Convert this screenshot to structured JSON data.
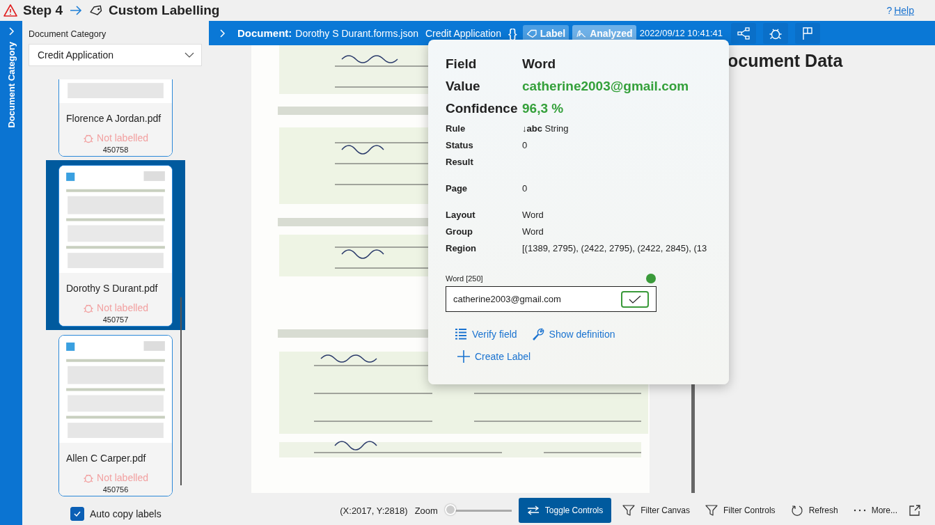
{
  "header": {
    "step": "Step 4",
    "title": "Custom Labelling",
    "help_mark": "?",
    "help": "Help"
  },
  "rail": {
    "label": "Document Category"
  },
  "category": {
    "label": "Document Category",
    "value": "Credit Application"
  },
  "documents": [
    {
      "name": "Florence A Jordan.pdf",
      "status": "Not labelled",
      "id": "450758",
      "selected": false
    },
    {
      "name": "Dorothy S Durant.pdf",
      "status": "Not labelled",
      "id": "450757",
      "selected": true
    },
    {
      "name": "Allen C Carper.pdf",
      "status": "Not labelled",
      "id": "450756",
      "selected": false
    }
  ],
  "auto_copy": {
    "label": "Auto copy labels",
    "checked": true
  },
  "toolbar": {
    "prefix": "Document:",
    "file": "Dorothy S Durant.forms.json",
    "category": "Credit Application",
    "braces": "{}",
    "chips": [
      {
        "label": "Label",
        "kind": "tag"
      },
      {
        "label": "Analyzed",
        "kind": "sign"
      }
    ],
    "timestamp": "2022/09/12 10:41:41"
  },
  "data_heading": "ocument Data",
  "popup": {
    "sections": [
      [
        {
          "label": "Field",
          "value": "Word",
          "kind": "heading"
        },
        {
          "label": "Value",
          "value": "catherine2003@gmail.com",
          "kind": "highlight"
        },
        {
          "label": "Confidence",
          "value": "96,3 %",
          "kind": "highlight"
        },
        {
          "label": "Rule",
          "value": "**↓abc**  String",
          "kind": "plain"
        },
        {
          "label": "Status",
          "value": "0",
          "kind": "plain"
        },
        {
          "label": "Result",
          "kind": "plain"
        }
      ],
      [
        {
          "label": "Page",
          "value": "0",
          "kind": "plain"
        }
      ],
      [
        {
          "label": "Layout",
          "value": "Word",
          "kind": "plain"
        },
        {
          "label": "Group",
          "value": "Word",
          "kind": "plain"
        },
        {
          "label": "Region",
          "value": "[(1389, 2795), (2422, 2795), (2422, 2845), (13",
          "kind": "plain"
        }
      ]
    ],
    "word_field": {
      "label": "Word [250]",
      "value": "catherine2003@gmail.com",
      "color": "#3a9a3a"
    },
    "actions": [
      {
        "label": "Verify field",
        "kind": "list"
      },
      {
        "label": "Show definition",
        "kind": "wrench"
      },
      {
        "label": "Create Label",
        "kind": "plus"
      }
    ]
  },
  "status_bar": {
    "coords": "(X:2017, Y:2818)",
    "zoom_label": "Zoom",
    "zoom": {
      "level": 0
    },
    "buttons": [
      {
        "label": "Toggle Controls",
        "kind": "toggle"
      },
      {
        "label": "Filter Canvas",
        "kind": "filter"
      },
      {
        "label": "Filter Controls",
        "kind": "filter"
      },
      {
        "label": "Refresh",
        "kind": "refresh"
      },
      {
        "label": "More...",
        "kind": "more"
      }
    ]
  }
}
